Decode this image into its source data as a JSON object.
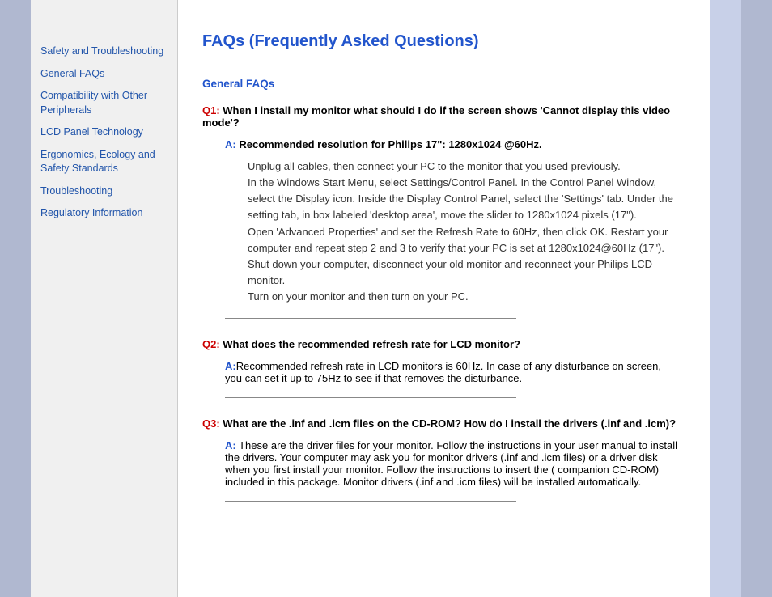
{
  "sidebar": {
    "links": [
      {
        "label": "Safety and Troubleshooting",
        "id": "safety"
      },
      {
        "label": "General FAQs",
        "id": "general-faqs"
      },
      {
        "label": "Compatibility with Other Peripherals",
        "id": "compatibility"
      },
      {
        "label": "LCD Panel Technology",
        "id": "lcd-panel"
      },
      {
        "label": "Ergonomics, Ecology and Safety Standards",
        "id": "ergonomics"
      },
      {
        "label": "Troubleshooting",
        "id": "troubleshooting"
      },
      {
        "label": "Regulatory Information",
        "id": "regulatory"
      }
    ]
  },
  "main": {
    "page_title": "FAQs (Frequently Asked Questions)",
    "section_heading": "General FAQs",
    "questions": [
      {
        "id": "q1",
        "q_label": "Q1:",
        "question_text": " When I install my monitor what should I do if the screen shows 'Cannot display this video mode'?",
        "a_label": "A:",
        "answer_bold": "Recommended resolution for Philips 17\": 1280x1024 @60Hz.",
        "answer_detail": "Unplug all cables, then connect your PC to the monitor that you used previously.\nIn the Windows Start Menu, select Settings/Control Panel. In the Control Panel Window, select the Display icon. Inside the Display Control Panel, select the 'Settings' tab. Under the setting tab, in box labeled 'desktop area', move the slider to 1280x1024 pixels (17\").\nOpen 'Advanced Properties' and set the Refresh Rate to 60Hz, then click OK. Restart your computer and repeat step 2 and 3 to verify that your PC is set at 1280x1024@60Hz (17\").\nShut down your computer, disconnect your old monitor and reconnect your Philips LCD monitor.\nTurn on your monitor and then turn on your PC."
      },
      {
        "id": "q2",
        "q_label": "Q2:",
        "question_text": " What does the recommended refresh rate for LCD monitor?",
        "a_label": "A:",
        "answer_bold": "",
        "answer_detail": "Recommended refresh rate in LCD monitors is 60Hz. In case of any disturbance on screen, you can set it up to 75Hz to see if that removes the disturbance."
      },
      {
        "id": "q3",
        "q_label": "Q3:",
        "question_text": " What are the .inf and .icm files on the CD-ROM? How do I install the drivers (.inf and .icm)?",
        "a_label": "A:",
        "answer_bold": "",
        "answer_detail": "These are the driver files for your monitor. Follow the instructions in your user manual to install the drivers. Your computer may ask you for monitor drivers (.inf and .icm files) or a driver disk when you first install your monitor. Follow the instructions to insert the ( companion CD-ROM) included in this package. Monitor drivers (.inf and .icm files) will be installed automatically."
      }
    ]
  }
}
